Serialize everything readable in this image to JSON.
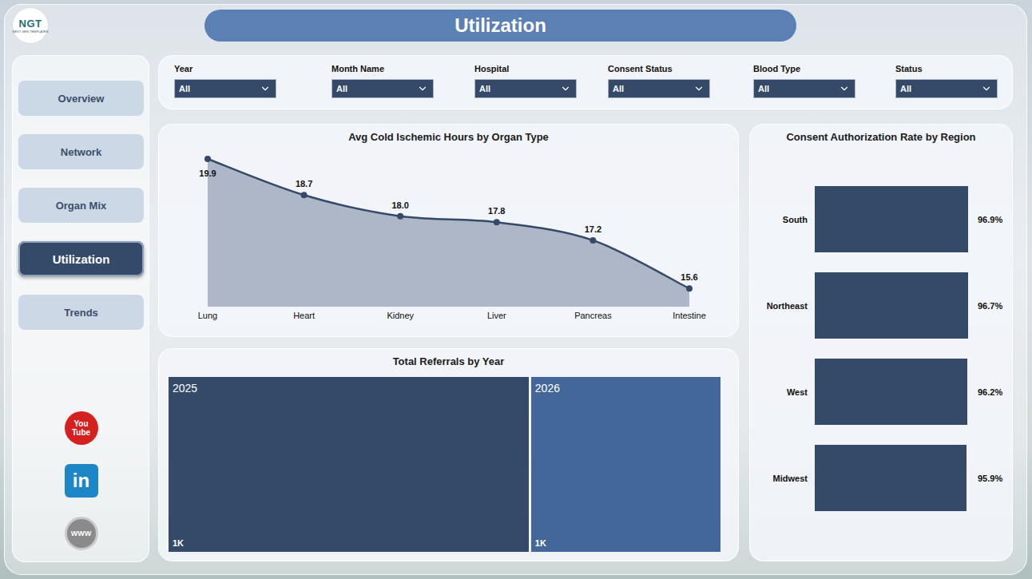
{
  "logo": {
    "mark": "NGT",
    "subtitle": "NEXT GEN TEMPLATES"
  },
  "header": {
    "title": "Utilization"
  },
  "nav": [
    {
      "label": "Overview",
      "selected": false
    },
    {
      "label": "Network",
      "selected": false
    },
    {
      "label": "Organ Mix",
      "selected": false
    },
    {
      "label": "Utilization",
      "selected": true
    },
    {
      "label": "Trends",
      "selected": false
    }
  ],
  "social": [
    {
      "kind": "youtube",
      "lines": [
        "You",
        "Tube"
      ]
    },
    {
      "kind": "linkedin",
      "lines": [
        "in"
      ]
    },
    {
      "kind": "web",
      "lines": [
        "WWW"
      ]
    }
  ],
  "filters": [
    {
      "label": "Year",
      "value": "All"
    },
    {
      "label": "Month Name",
      "value": "All"
    },
    {
      "label": "Hospital",
      "value": "All"
    },
    {
      "label": "Consent Status",
      "value": "All"
    },
    {
      "label": "Blood Type",
      "value": "All"
    },
    {
      "label": "Status",
      "value": "All"
    }
  ],
  "ischemic_chart": {
    "title": "Avg Cold Ischemic Hours by Organ Type",
    "categories": [
      "Lung",
      "Heart",
      "Kidney",
      "Liver",
      "Pancreas",
      "Intestine"
    ],
    "values": [
      19.9,
      18.7,
      18.0,
      17.8,
      17.2,
      15.6
    ],
    "labels": [
      "19.9",
      "18.7",
      "18.0",
      "17.8",
      "17.2",
      "15.6"
    ]
  },
  "referrals_chart": {
    "title": "Total Referrals by Year",
    "tiles": [
      {
        "year": "2025",
        "value": 1300,
        "label": "1K",
        "color": "#344a68"
      },
      {
        "year": "2026",
        "value": 670,
        "label": "1K",
        "color": "#44679a"
      }
    ]
  },
  "consent_chart": {
    "title": "Consent Authorization Rate by Region",
    "bars": [
      {
        "region": "South",
        "value": 96.9,
        "label": "96.9%"
      },
      {
        "region": "Northeast",
        "value": 96.7,
        "label": "96.7%"
      },
      {
        "region": "West",
        "value": 96.2,
        "label": "96.2%"
      },
      {
        "region": "Midwest",
        "value": 95.9,
        "label": "95.9%"
      }
    ]
  }
}
